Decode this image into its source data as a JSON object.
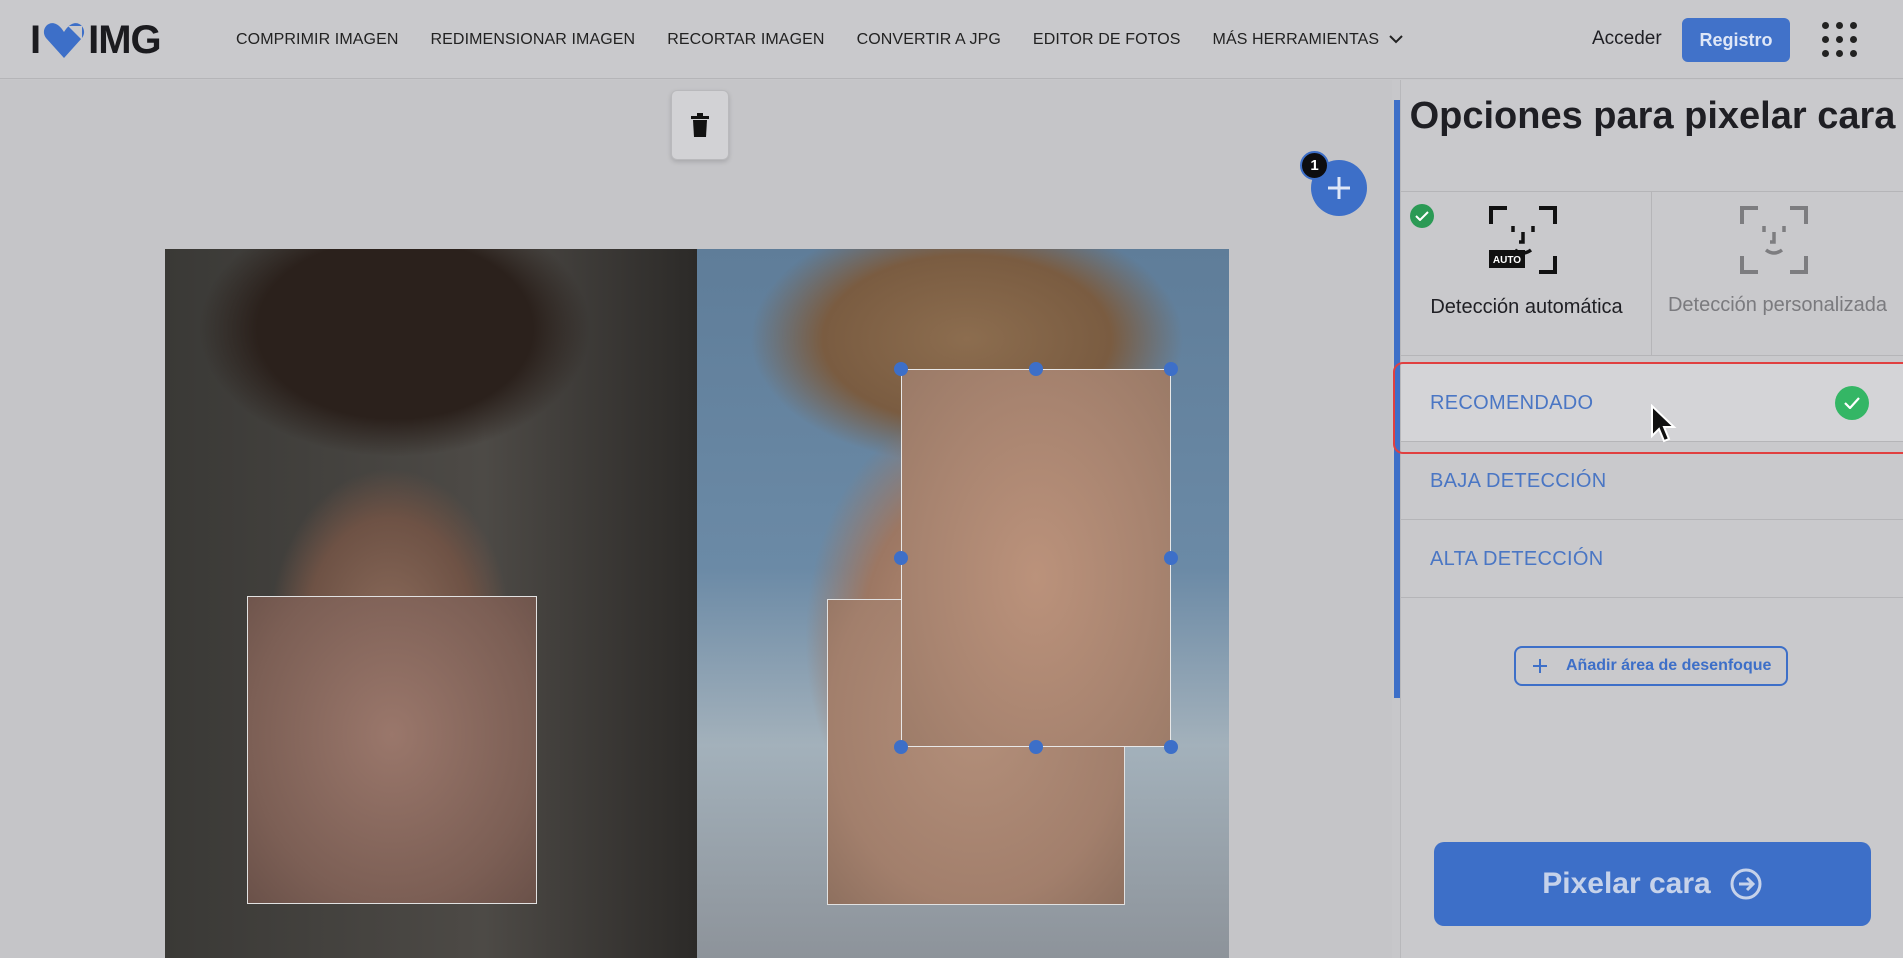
{
  "header": {
    "logo_text_left": "I",
    "logo_text_right": "IMG",
    "nav": [
      {
        "label": "COMPRIMIR IMAGEN"
      },
      {
        "label": "REDIMENSIONAR IMAGEN"
      },
      {
        "label": "RECORTAR IMAGEN"
      },
      {
        "label": "CONVERTIR A JPG"
      },
      {
        "label": "EDITOR DE FOTOS"
      },
      {
        "label": "MÁS HERRAMIENTAS"
      }
    ],
    "login_label": "Acceder",
    "register_label": "Registro"
  },
  "workspace": {
    "file_count_badge": "1",
    "icons": {
      "delete": "trash-icon",
      "add": "plus-icon"
    }
  },
  "sidebar": {
    "title": "Opciones para pixelar cara",
    "modes": [
      {
        "label": "Detección automática",
        "selected": true,
        "icon_text": "AUTO"
      },
      {
        "label": "Detección personalizada",
        "selected": false
      }
    ],
    "options": [
      {
        "label": "RECOMENDADO",
        "selected": true
      },
      {
        "label": "BAJA DETECCIÓN",
        "selected": false
      },
      {
        "label": "ALTA DETECCIÓN",
        "selected": false
      }
    ],
    "add_area_label": "Añadir área de desenfoque",
    "submit_label": "Pixelar cara"
  },
  "colors": {
    "accent": "#3d6fc8",
    "check_green": "#34b665",
    "highlight_red": "#e04040"
  }
}
